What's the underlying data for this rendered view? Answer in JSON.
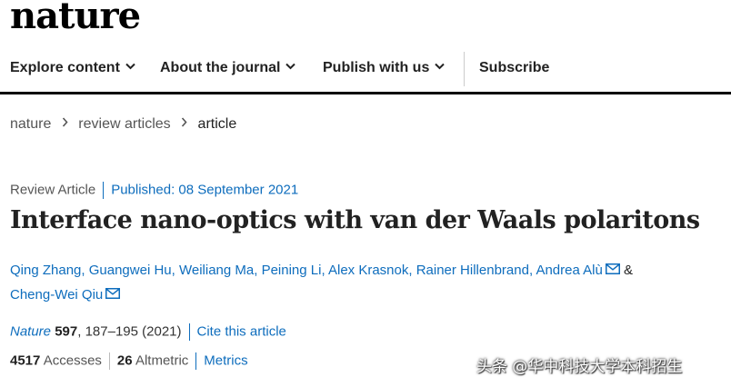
{
  "site": {
    "logo": "nature"
  },
  "nav": {
    "explore": "Explore content",
    "about": "About the journal",
    "publish": "Publish with us",
    "subscribe": "Subscribe"
  },
  "breadcrumb": [
    "nature",
    "review articles",
    "article"
  ],
  "article": {
    "type": "Review Article",
    "published": "Published: 08 September 2021",
    "title": "Interface nano-optics with van der Waals polaritons",
    "authors": [
      "Qing Zhang",
      "Guangwei Hu",
      "Weiliang Ma",
      "Peining Li",
      "Alex Krasnok",
      "Rainer Hillenbrand",
      "Andrea Alù",
      "Cheng-Wei Qiu"
    ],
    "ampersand": "&",
    "journal": "Nature",
    "volume": "597",
    "pages": ", 187–195 (2021)",
    "cite": "Cite this article",
    "accesses_count": "4517",
    "accesses_label": "Accesses",
    "altmetric_count": "26",
    "altmetric_label": "Altmetric",
    "metrics_link": "Metrics"
  },
  "watermark": "头条 @华中科技大学本科招生",
  "colors": {
    "link": "#0e6dbd",
    "text": "#222222",
    "nav_border": "#000000"
  }
}
